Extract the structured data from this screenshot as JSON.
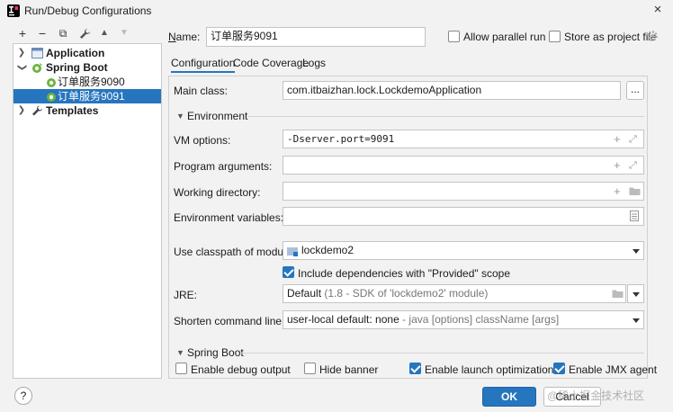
{
  "window": {
    "title": "Run/Debug Configurations",
    "close_label": "×"
  },
  "toolbar": {
    "add": "+",
    "remove": "−",
    "copy": "⧉",
    "edit": "✎",
    "up": "▲",
    "down": "▼"
  },
  "tree": {
    "application": "Application",
    "spring_boot": "Spring Boot",
    "config_9090": "订单服务9090",
    "config_9091": "订单服务9091",
    "templates": "Templates"
  },
  "header": {
    "name_label": "Name:",
    "name_value": "订单服务9091",
    "allow_parallel": "Allow parallel run",
    "store_project": "Store as project file"
  },
  "tabs": [
    "Configuration",
    "Code Coverage",
    "Logs"
  ],
  "form": {
    "main_class_label": "Main class:",
    "main_class_value": "com.itbaizhan.lock.LockdemoApplication",
    "browse": "...",
    "environment": "Environment",
    "vm_options_label": "VM options:",
    "vm_options_value": "-Dserver.port=9091",
    "program_args_label": "Program arguments:",
    "working_dir_label": "Working directory:",
    "env_vars_label": "Environment variables:",
    "classpath_label": "Use classpath of module:",
    "classpath_value": "lockdemo2",
    "include_provided": "Include dependencies with \"Provided\" scope",
    "jre_label": "JRE:",
    "jre_value": "Default",
    "jre_hint": "(1.8 - SDK of 'lockdemo2' module)",
    "shorten_label": "Shorten command line:",
    "shorten_value": "user-local default: none",
    "shorten_hint": " - java [options] className [args]",
    "spring_boot_section": "Spring Boot",
    "debug_output": "Enable debug output",
    "hide_banner": "Hide banner",
    "launch_opt": "Enable launch optimization",
    "jmx": "Enable JMX agent"
  },
  "footer": {
    "help": "?",
    "ok": "OK",
    "cancel": "Cancel",
    "watermark": "@稀土掘金技术社区"
  },
  "colors": {
    "accent": "#2675bf",
    "spring_green": "#6db33f"
  }
}
